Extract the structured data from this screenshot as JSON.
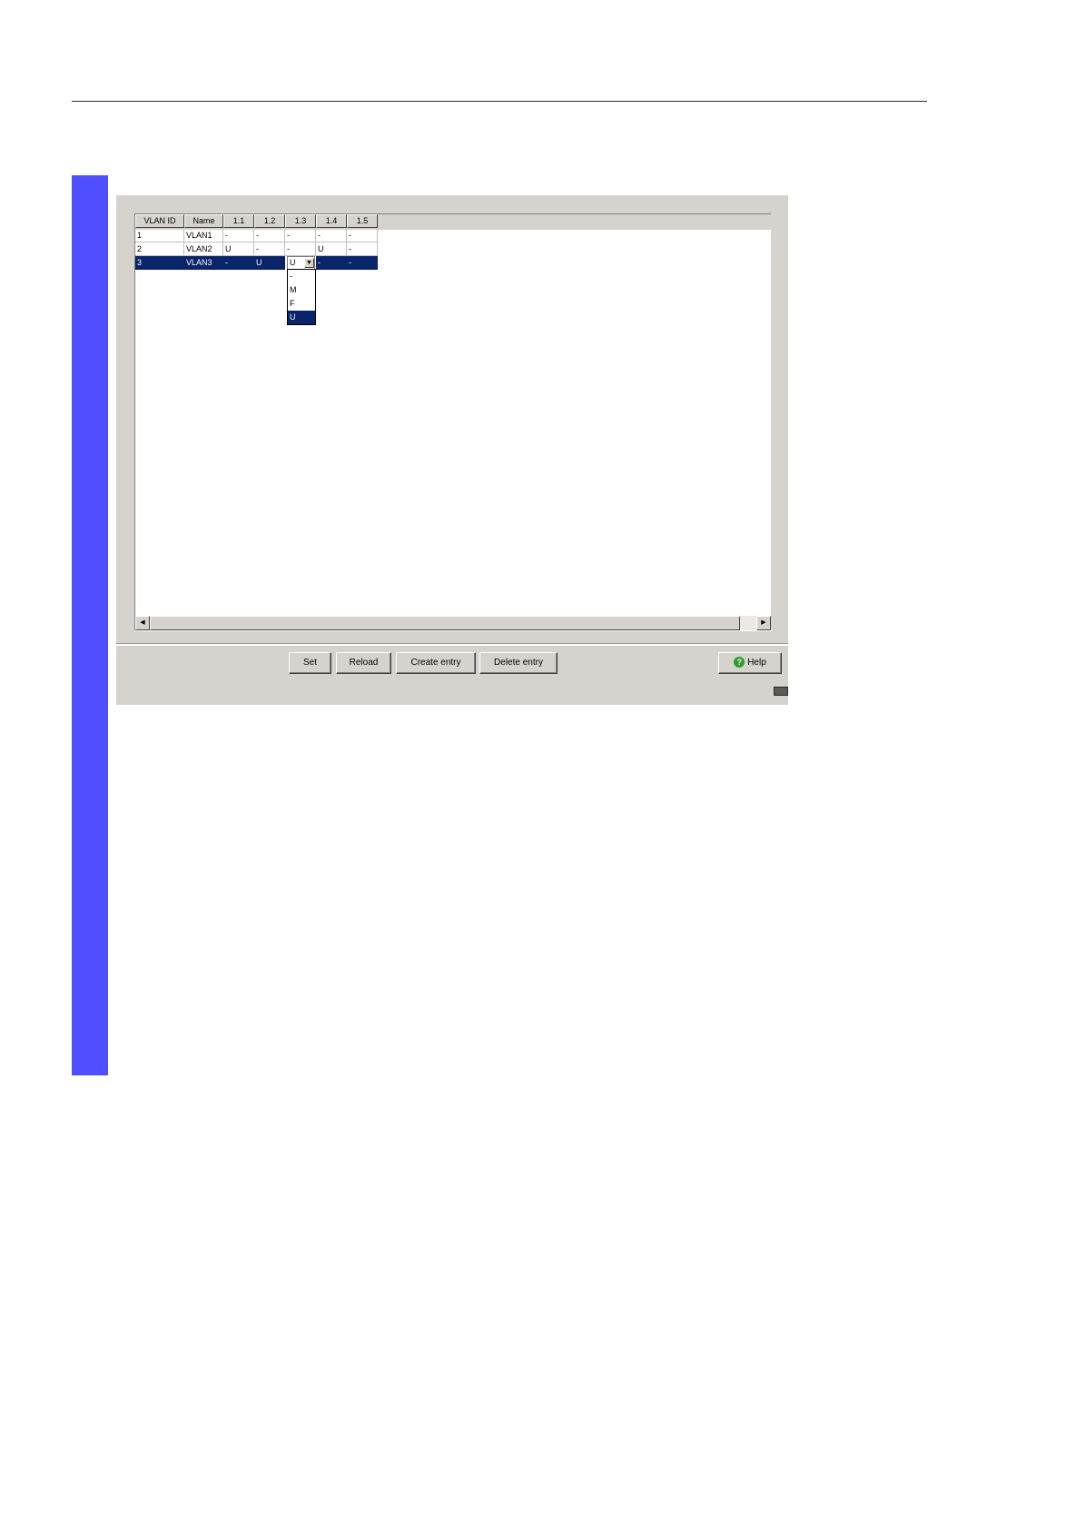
{
  "table": {
    "columns": [
      "VLAN ID",
      "Name",
      "1.1",
      "1.2",
      "1.3",
      "1.4",
      "1.5"
    ],
    "rows": [
      {
        "id": "1",
        "name": "VLAN1",
        "p11": "-",
        "p12": "-",
        "p13": "-",
        "p14": "-",
        "p15": "-"
      },
      {
        "id": "2",
        "name": "VLAN2",
        "p11": "U",
        "p12": "-",
        "p13": "-",
        "p14": "U",
        "p15": "-"
      },
      {
        "id": "3",
        "name": "VLAN3",
        "p11": "-",
        "p12": "U",
        "p13": "U",
        "p14": "-",
        "p15": "-"
      }
    ],
    "selected_row": 3
  },
  "dropdown": {
    "current": "U",
    "options": [
      "-",
      "M",
      "F",
      "U"
    ],
    "highlighted": "U"
  },
  "buttons": {
    "set": "Set",
    "reload": "Reload",
    "create": "Create entry",
    "delete": "Delete entry",
    "help": "Help"
  },
  "colors": {
    "accent_bar": "#4f4fff",
    "selection": "#0a246a",
    "panel": "#d6d3ce"
  },
  "icons": {
    "help": "help-icon",
    "combo_arrow": "chevron-down-icon",
    "scroll_left": "arrow-left-icon",
    "scroll_right": "arrow-right-icon"
  }
}
